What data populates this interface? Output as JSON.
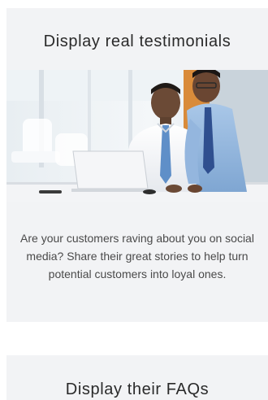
{
  "cards": [
    {
      "title": "Display real testimonials",
      "image_alt": "photo",
      "body": "Are your customers raving about you on social media? Share their great stories to help turn potential customers into loyal ones."
    },
    {
      "title": "Display their FAQs"
    }
  ],
  "colors": {
    "page_background": "#ffffff",
    "card_background": "#f2f3f5",
    "title_text": "#2a2a2a",
    "body_text": "#4a4a4a"
  }
}
